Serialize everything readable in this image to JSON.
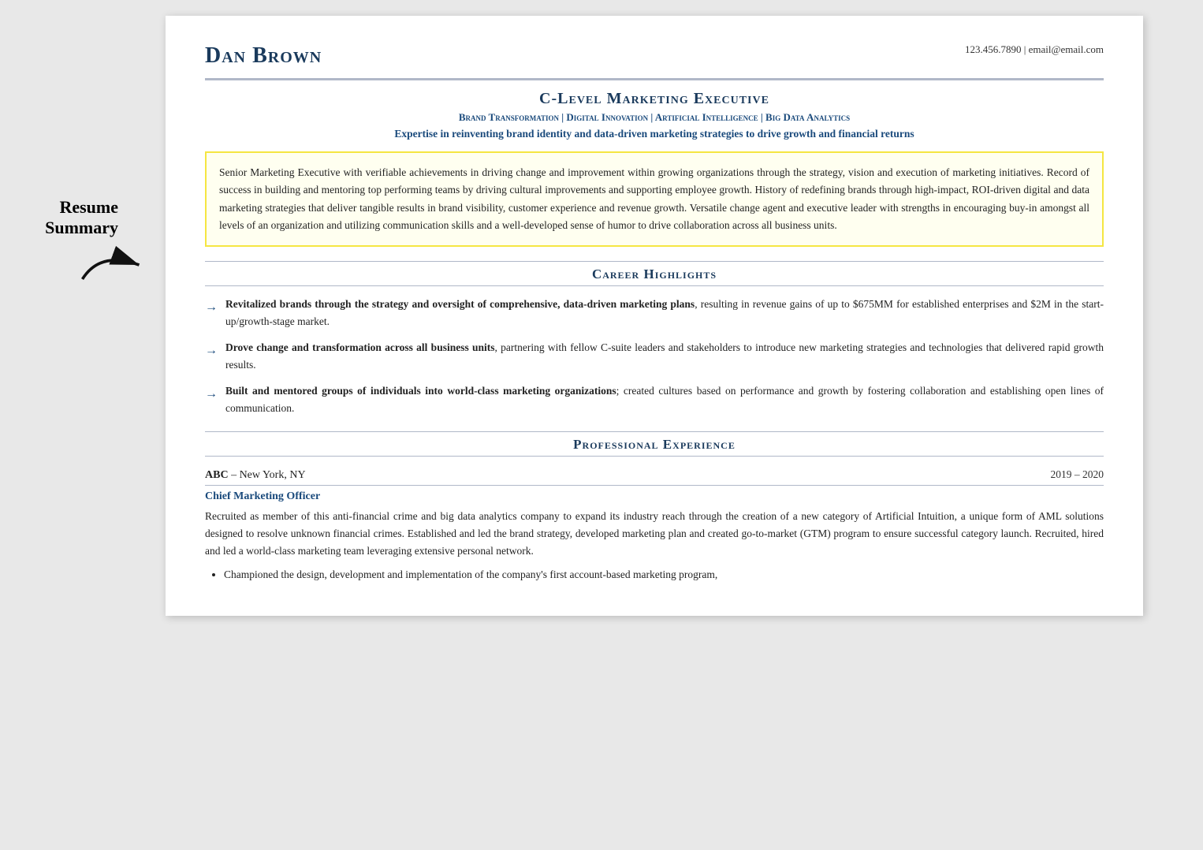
{
  "label": {
    "resume_summary": "Resume\nSummary"
  },
  "header": {
    "name": "Dan Brown",
    "contact": "123.456.7890  |  email@email.com",
    "job_title": "C-Level Marketing Executive",
    "specialties": "Brand Transformation  |  Digital Innovation  |  Artificial Intelligence  |  Big Data Analytics",
    "expertise": "Expertise in reinventing brand identity and data-driven marketing strategies to drive growth and financial returns"
  },
  "summary": {
    "text": "Senior Marketing Executive with verifiable achievements in driving change and improvement within growing organizations through the strategy, vision and execution of marketing initiatives. Record of success in building and mentoring top performing teams by driving cultural improvements and supporting employee growth. History of redefining brands through high-impact, ROI-driven digital and data marketing strategies that deliver tangible results in brand visibility, customer experience and revenue growth. Versatile change agent and executive leader with strengths in encouraging buy-in amongst all levels of an organization and utilizing communication skills and a well-developed sense of humor to drive collaboration across all business units."
  },
  "career_highlights": {
    "section_title": "Career Highlights",
    "items": [
      {
        "bold": "Revitalized brands through the strategy and oversight of comprehensive, data-driven marketing plans",
        "rest": ", resulting in revenue gains of up to $675MM for established enterprises and $2M in the start-up/growth-stage market."
      },
      {
        "bold": "Drove change and transformation across all business units",
        "rest": ", partnering with fellow C-suite leaders and stakeholders to introduce new marketing strategies and technologies that delivered rapid growth results."
      },
      {
        "bold": "Built and mentored groups of individuals into world-class marketing organizations",
        "rest": "; created cultures based on performance and growth by fostering collaboration and establishing open lines of communication."
      }
    ]
  },
  "professional_experience": {
    "section_title": "Professional Experience",
    "jobs": [
      {
        "company": "ABC",
        "company_suffix": " – New York, NY",
        "dates": "2019 – 2020",
        "title": "Chief Marketing Officer",
        "description": "Recruited as member of this anti-financial crime and big data analytics company to expand its industry reach through the creation of a new category of Artificial Intuition, a unique form of AML solutions designed to resolve unknown financial crimes. Established and led the brand strategy, developed marketing plan and created go-to-market (GTM) program to ensure successful category launch. Recruited, hired and led a world-class marketing team leveraging extensive personal network.",
        "bullets": [
          "Championed the design, development and implementation of the company's first account-based marketing program,"
        ]
      }
    ]
  },
  "icons": {
    "arrow": "→"
  }
}
